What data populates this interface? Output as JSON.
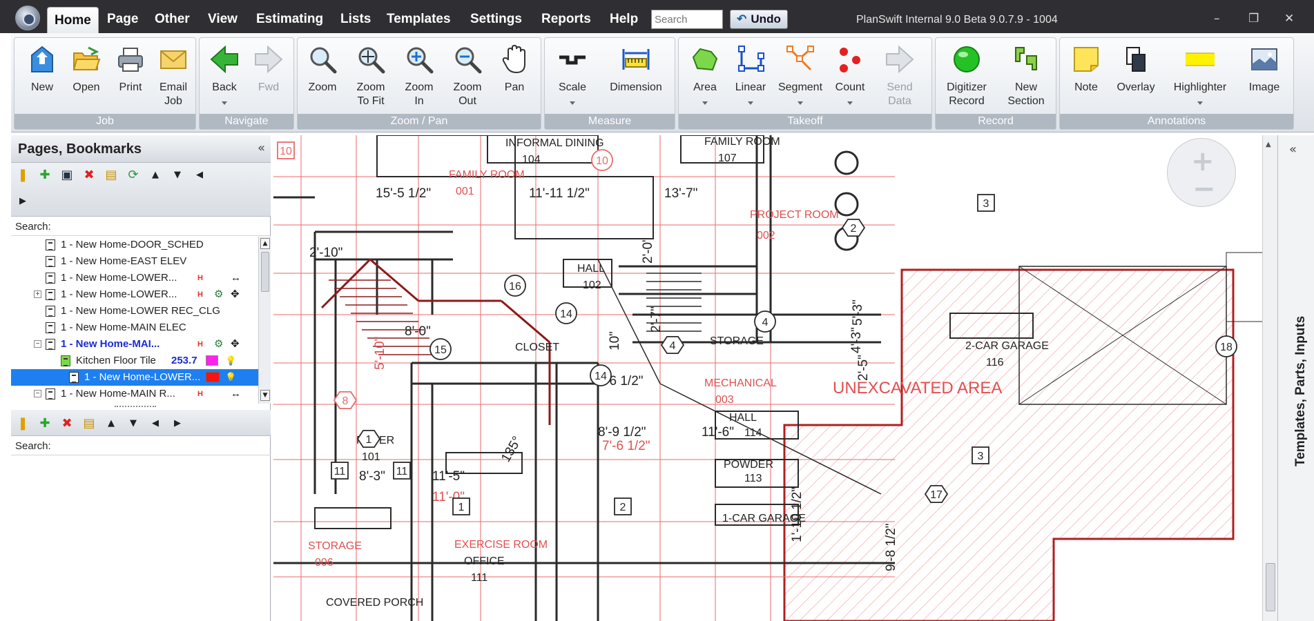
{
  "titlebar": {
    "menus": [
      "Home",
      "Page",
      "Other",
      "View",
      "Estimating",
      "Lists",
      "Templates",
      "Settings",
      "Reports",
      "Help"
    ],
    "active_menu": "Home",
    "search_placeholder": "Search",
    "undo_label": "Undo",
    "app_title": "PlanSwift Internal 9.0 Beta  9.0.7.9 - 1004",
    "window_controls": [
      "–",
      "❐",
      "✕"
    ]
  },
  "ribbon": {
    "groups": [
      {
        "label": "Job",
        "buttons": [
          {
            "label": "New",
            "icon": "new-document-icon"
          },
          {
            "label": "Open",
            "icon": "folder-open-icon"
          },
          {
            "label": "Print",
            "icon": "printer-icon"
          },
          {
            "label": "Email\nJob",
            "icon": "envelope-icon"
          }
        ]
      },
      {
        "label": "Navigate",
        "buttons": [
          {
            "label": "Back",
            "icon": "back-arrow-icon",
            "caret": true
          },
          {
            "label": "Fwd",
            "icon": "forward-arrow-icon",
            "disabled": true
          }
        ]
      },
      {
        "label": "Zoom / Pan",
        "buttons": [
          {
            "label": "Zoom",
            "icon": "magnifier-icon"
          },
          {
            "label": "Zoom\nTo Fit",
            "icon": "zoom-fit-icon"
          },
          {
            "label": "Zoom\nIn",
            "icon": "zoom-in-icon"
          },
          {
            "label": "Zoom\nOut",
            "icon": "zoom-out-icon"
          },
          {
            "label": "Pan",
            "icon": "hand-icon"
          }
        ]
      },
      {
        "label": "Measure",
        "buttons": [
          {
            "label": "Scale",
            "icon": "scale-icon",
            "caret": true
          },
          {
            "label": "Dimension",
            "icon": "dimension-icon"
          }
        ]
      },
      {
        "label": "Takeoff",
        "buttons": [
          {
            "label": "Area",
            "icon": "area-icon",
            "caret": true
          },
          {
            "label": "Linear",
            "icon": "linear-icon",
            "caret": true
          },
          {
            "label": "Segment",
            "icon": "segment-icon",
            "caret": true
          },
          {
            "label": "Count",
            "icon": "count-icon",
            "caret": true
          },
          {
            "label": "Send\nData",
            "icon": "send-data-icon",
            "disabled": true
          }
        ]
      },
      {
        "label": "Record",
        "buttons": [
          {
            "label": "Digitizer\nRecord",
            "icon": "record-icon"
          },
          {
            "label": "New\nSection",
            "icon": "new-section-icon"
          }
        ]
      },
      {
        "label": "Annotations",
        "buttons": [
          {
            "label": "Note",
            "icon": "note-icon"
          },
          {
            "label": "Overlay",
            "icon": "overlay-icon"
          },
          {
            "label": "Highlighter",
            "icon": "highlighter-icon",
            "caret": true
          },
          {
            "label": "Image",
            "icon": "image-icon"
          }
        ]
      }
    ]
  },
  "left_panel": {
    "title": "Pages, Bookmarks",
    "collapse_glyph": "«",
    "search_label": "Search:",
    "tree": [
      {
        "text": "1 - New Home-DOOR_SCHED",
        "level": 1
      },
      {
        "text": "1 - New Home-EAST ELEV",
        "level": 1
      },
      {
        "text": "1 - New Home-LOWER...",
        "level": 1,
        "badges": [
          "h",
          "arrows"
        ]
      },
      {
        "text": "1 - New Home-LOWER...",
        "level": 1,
        "expander": "+",
        "badges": [
          "h",
          "gear",
          "move"
        ]
      },
      {
        "text": "1 - New Home-LOWER REC_CLG",
        "level": 1
      },
      {
        "text": "1 - New Home-MAIN ELEC",
        "level": 1
      },
      {
        "text": "1 - New Home-MAI...",
        "level": 1,
        "expander": "−",
        "bold": true,
        "badges": [
          "h",
          "gear",
          "move"
        ]
      },
      {
        "text": "Kitchen Floor Tile",
        "level": 2,
        "value": "253.7",
        "item": true,
        "badges": [
          "magenta",
          "bulb"
        ]
      },
      {
        "text": "1 - New Home-LOWER...",
        "level": 3,
        "selected": true,
        "badges": [
          "red",
          "bulb"
        ]
      },
      {
        "text": "1 - New Home-MAIN R...",
        "level": 1,
        "expander": "−",
        "badges": [
          "h",
          "arrows"
        ]
      }
    ]
  },
  "drawing": {
    "labels": [
      {
        "t": "INFORMAL DINING",
        "c": "#222"
      },
      {
        "t": "104",
        "c": "#222"
      },
      {
        "t": "FAMILY ROOM",
        "c": "#222"
      },
      {
        "t": "107",
        "c": "#222"
      },
      {
        "t": "FAMILY ROOM",
        "c": "#e05050"
      },
      {
        "t": "001",
        "c": "#e05050"
      },
      {
        "t": "15'-5 1/2\"",
        "c": "#222"
      },
      {
        "t": "11'-11 1/2\"",
        "c": "#222"
      },
      {
        "t": "13'-7\"",
        "c": "#222"
      },
      {
        "t": "PROJECT ROOM",
        "c": "#e05050"
      },
      {
        "t": "002",
        "c": "#e05050"
      },
      {
        "t": "HALL",
        "c": "#222"
      },
      {
        "t": "102",
        "c": "#222"
      },
      {
        "t": "STORAGE",
        "c": "#222"
      },
      {
        "t": "2-CAR GARAGE",
        "c": "#222"
      },
      {
        "t": "116",
        "c": "#222"
      },
      {
        "t": "UNEXCAVATED AREA",
        "c": "#e05050"
      },
      {
        "t": "MECHANICAL",
        "c": "#e05050"
      },
      {
        "t": "003",
        "c": "#e05050"
      },
      {
        "t": "FOYER",
        "c": "#222"
      },
      {
        "t": "101",
        "c": "#222"
      },
      {
        "t": "8'-3\"",
        "c": "#222"
      },
      {
        "t": "11'-5\"",
        "c": "#222"
      },
      {
        "t": "11'-0\"",
        "c": "#e05050"
      },
      {
        "t": "EXERCISE ROOM",
        "c": "#e05050"
      },
      {
        "t": "OFFICE",
        "c": "#222"
      },
      {
        "t": "111",
        "c": "#222"
      },
      {
        "t": "HALL",
        "c": "#222"
      },
      {
        "t": "114",
        "c": "#222"
      },
      {
        "t": "POWDER",
        "c": "#222"
      },
      {
        "t": "113",
        "c": "#222"
      },
      {
        "t": "1-CAR GARAGE",
        "c": "#222"
      },
      {
        "t": "COVERED PORCH",
        "c": "#222"
      },
      {
        "t": "5'-6 1/2\"",
        "c": "#222"
      },
      {
        "t": "8'-9 1/2\"",
        "c": "#222"
      },
      {
        "t": "7'-6 1/2\"",
        "c": "#e05050"
      },
      {
        "t": "11'-6\"",
        "c": "#222"
      },
      {
        "t": "1'-10 1/2\"",
        "c": "#222"
      },
      {
        "t": "9'-8 1/2\"",
        "c": "#222"
      },
      {
        "t": "8'-0\"",
        "c": "#222"
      },
      {
        "t": "5'-10\"",
        "c": "#e05050"
      },
      {
        "t": "10\"",
        "c": "#222"
      },
      {
        "t": "STORAGE",
        "c": "#e05050"
      },
      {
        "t": "006",
        "c": "#e05050"
      },
      {
        "t": "4'-3\"",
        "c": "#222"
      },
      {
        "t": "2'-5\"",
        "c": "#222"
      },
      {
        "t": "5'-3\"",
        "c": "#222"
      },
      {
        "t": "2'-7\"",
        "c": "#222"
      },
      {
        "t": "2'-0\"",
        "c": "#222"
      },
      {
        "t": "2'-10\"",
        "c": "#222"
      },
      {
        "t": "135°",
        "c": "#222"
      },
      {
        "t": "CLOSET",
        "c": "#222"
      }
    ],
    "tags": [
      "3",
      "2",
      "3",
      "14",
      "15",
      "14",
      "16",
      "4",
      "4",
      "1",
      "11",
      "11",
      "1",
      "2",
      "17",
      "10",
      "10",
      "8",
      "18"
    ]
  },
  "right_panel": {
    "collapse_glyph": "«",
    "label": "Templates, Parts, Inputs"
  }
}
